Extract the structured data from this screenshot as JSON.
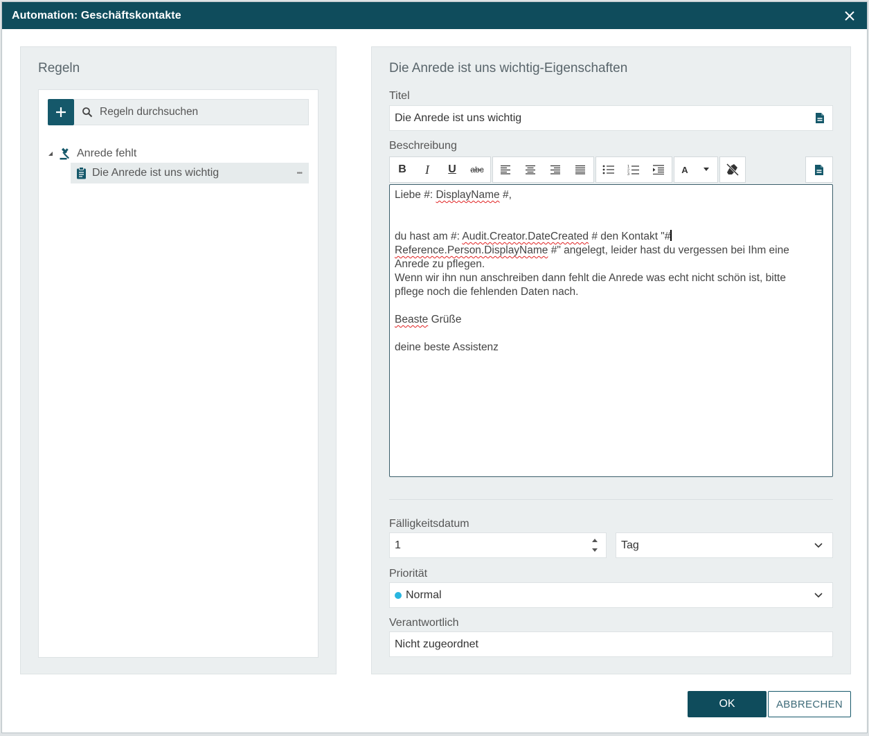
{
  "window": {
    "title": "Automation: Geschäftskontakte"
  },
  "left_panel": {
    "heading": "Regeln",
    "search_placeholder": "Regeln durchsuchen",
    "tree": {
      "group_label": "Anrede fehlt",
      "item_label": "Die Anrede ist uns wichtig",
      "item_menu": "•••"
    }
  },
  "right_panel": {
    "heading": "Die Anrede ist uns wichtig-Eigenschaften",
    "titel_label": "Titel",
    "titel_value": "Die Anrede ist uns wichtig",
    "beschreibung_label": "Beschreibung",
    "toolbar": {
      "bold": "B",
      "italic": "I",
      "underline": "U",
      "strikethrough": "abc",
      "font_color": "A"
    },
    "editor": {
      "line1_pre": "Liebe #: ",
      "line1_var": "DisplayName",
      "line1_post": " #,",
      "line2_pre": "du hast am #: ",
      "line2_var": "Audit.Creator.DateCreated",
      "line2_mid": " # den Kontakt \"#",
      "line3_var": "Reference.Person.DisplayName",
      "line3_post": " #\" angelegt, leider hast du vergessen bei Ihm eine",
      "line4": "Anrede zu pflegen.",
      "line5": "Wenn wir ihn nun anschreiben dann fehlt die Anrede was echt nicht schön ist, bitte",
      "line6": "pflege noch die fehlenden Daten nach.",
      "line7_var": "Beaste",
      "line7_post": " Grüße",
      "line8": "deine beste Assistenz"
    },
    "faelligkeit_label": "Fälligkeitsdatum",
    "faelligkeit_value": "1",
    "faelligkeit_unit": "Tag",
    "prioritaet_label": "Priorität",
    "prioritaet_value": "Normal",
    "prioritaet_color": "#29b6e0",
    "verantwortlich_label": "Verantwortlich",
    "verantwortlich_value": "Nicht zugeordnet"
  },
  "footer": {
    "ok_label": "OK",
    "cancel_label": "ABBRECHEN"
  }
}
